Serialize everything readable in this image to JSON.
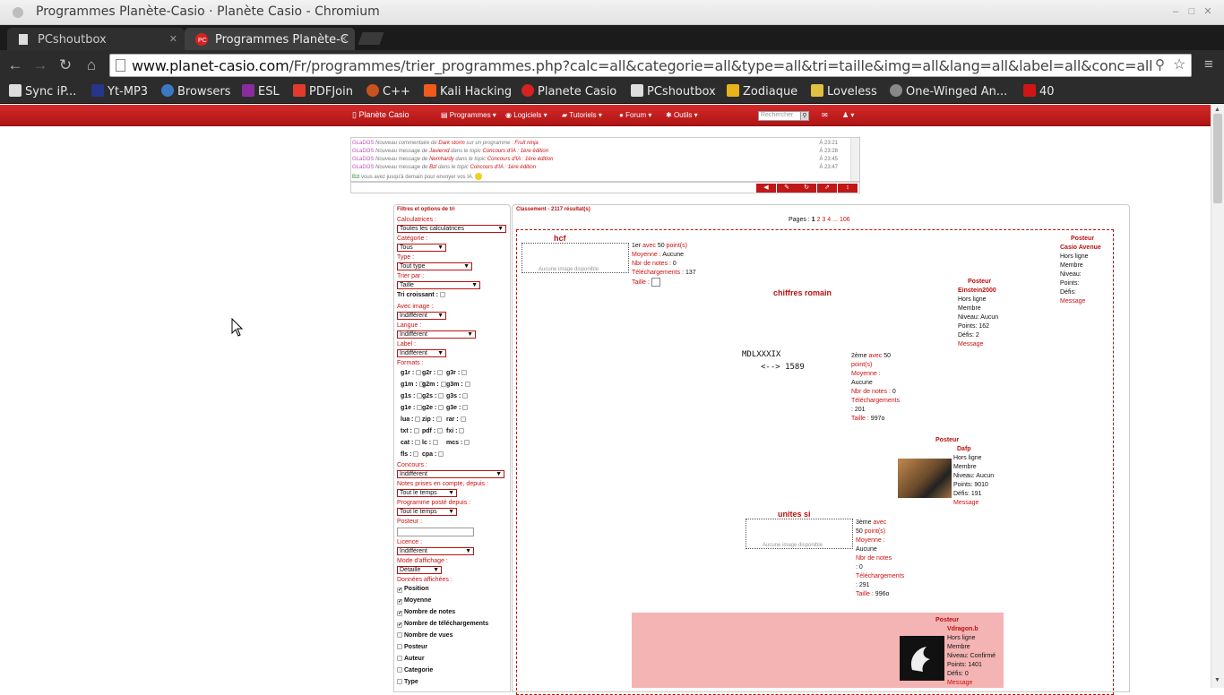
{
  "window": {
    "title": "Programmes Planète-Casio · Planète Casio - Chromium"
  },
  "tabs": [
    {
      "label": "PCshoutbox"
    },
    {
      "label": "Programmes Planète-C"
    }
  ],
  "address": {
    "host": "www.planet-casio.com",
    "path": "/Fr/programmes/trier_programmes.php?calc=all&categorie=all&type=all&tri=taille&img=all&lang=all&label=all&conc=all&not"
  },
  "bookmarks": [
    "Sync iP...",
    "Yt-MP3",
    "Browsers",
    "ESL",
    "PDFJoin",
    "C++",
    "Kali Hacking",
    "Planete Casio",
    "PCshoutbox",
    "Zodiaque",
    "Loveless",
    "One-Winged An...",
    "40"
  ],
  "site": {
    "brand": "Planète Casio",
    "menu": [
      "Programmes",
      "Logiciels",
      "Tutoriels",
      "Forum",
      "Outils"
    ],
    "search_placeholder": "Rechercher"
  },
  "shoutbox": [
    {
      "user": "GLaDOS",
      "text": "Nouveau commentaire de ",
      "who": "Dark storm",
      "mid": " sur un programme : ",
      "what": "Fruit ninja",
      "time": "À 23:21"
    },
    {
      "user": "GLaDOS",
      "text": "Nouveau message de ",
      "who": "Javierxd",
      "mid": " dans le topic ",
      "what": "Concours d'IA : 1ère édition",
      "time": "À 23:28"
    },
    {
      "user": "GLaDOS",
      "text": "Nouveau message de ",
      "who": "Nemhardy",
      "mid": " dans le topic ",
      "what": "Concours d'IA : 1ère édition",
      "time": "À 23:45"
    },
    {
      "user": "GLaDOS",
      "text": "Nouveau message de ",
      "who": "Bzl",
      "mid": " dans le topic ",
      "what": "Concours d'IA : 1ère édition",
      "time": "À 23:47"
    },
    {
      "user": "Bzl",
      "text": "vous avez jusqu'à demain pour envoyer vos IA.",
      "who": "",
      "mid": "",
      "what": "",
      "time": ""
    }
  ],
  "filters": {
    "title": "Filtres et options de tri",
    "calc_label": "Calculatrices :",
    "calc_value": "Toutes les calculatrices",
    "cat_label": "Catégorie :",
    "cat_value": "Tous",
    "type_label": "Type :",
    "type_value": "Tout type",
    "sort_label": "Trier par :",
    "sort_value": "Taille",
    "asc_label": "Tri croissant :",
    "img_label": "Avec image :",
    "img_value": "Indifférent",
    "lang_label": "Langue :",
    "lang_value": "Indifférent",
    "label_label": "Label :",
    "label_value": "Indifférent",
    "formats_label": "Formats :",
    "formats": [
      "g1r :",
      "g2r :",
      "g3r :",
      "g1m :",
      "g2m :",
      "g3m :",
      "g1s :",
      "g2s :",
      "g3s :",
      "g1e :",
      "g2e :",
      "g3e :",
      "lua :",
      "zip :",
      "rar :",
      "txt :",
      "pdf :",
      "fxi :",
      "cat :",
      "lc :",
      "mcs :",
      "fls :",
      "cpa :"
    ],
    "conc_label": "Concours :",
    "conc_value": "Indifférent",
    "notes_label": "Notes prises en compte, depuis :",
    "notes_value": "Tout le temps",
    "posted_label": "Programme posté depuis :",
    "posted_value": "Tout le temps",
    "poster_label": "Posteur :",
    "licence_label": "Licence :",
    "licence_value": "Indifférent",
    "mode_label": "Mode d'affichage :",
    "mode_value": "Détaillé",
    "data_label": "Données affichées :",
    "data": [
      {
        "label": "Position",
        "checked": true
      },
      {
        "label": "Moyenne",
        "checked": true
      },
      {
        "label": "Nombre de notes",
        "checked": true
      },
      {
        "label": "Nombre de téléchargements",
        "checked": true
      },
      {
        "label": "Nombre de vues",
        "checked": false
      },
      {
        "label": "Posteur",
        "checked": false
      },
      {
        "label": "Auteur",
        "checked": false
      },
      {
        "label": "Categorie",
        "checked": false
      },
      {
        "label": "Type",
        "checked": false
      }
    ]
  },
  "results": {
    "title": "Classement - 2117 résultat(s)",
    "pages_label": "Pages :",
    "pages": [
      "1",
      "2",
      "3",
      "4",
      "...",
      "106"
    ],
    "noimg": "Aucune image disponible",
    "items": [
      {
        "name": "hcf",
        "rank": "1er",
        "avec": "avec",
        "pts": "50",
        "ptslabel": "point(s)",
        "moy_label": "Moyenne :",
        "moy": "Aucune",
        "notes_label": "Nbr de notes :",
        "notes": "0",
        "dl_label": "Téléchargements :",
        "dl": "137",
        "size_label": "Taille :",
        "size": "",
        "poster_head": "Posteur",
        "poster": "Casio Avenue",
        "status": "Hors ligne",
        "role": "Membre",
        "niveau": "Niveau:",
        "points": "Points:",
        "defis": "Défis:",
        "msg": "Message"
      },
      {
        "name": "chiffres romain",
        "code1": "MDLXXXIX",
        "code2": "<--> 1589",
        "rank": "2ème",
        "avec": "avec",
        "pts": "50",
        "ptslabel": "point(s)",
        "moy_label": "Moyenne :",
        "moy": "Aucune",
        "notes_label": "Nbr de notes :",
        "notes": "0",
        "dl_label": "Téléchargements",
        "dl": ": 201",
        "size_label": "Taille :",
        "size": "997o",
        "poster_head": "Posteur",
        "poster": "Einstein2000",
        "status": "Hors ligne",
        "role": "Membre",
        "niveau": "Niveau: Aucun",
        "points": "Points: 162",
        "defis": "Défis: 2",
        "msg": "Message"
      },
      {
        "name": "unites si",
        "rank": "3ème",
        "avec": "avec",
        "pts": "50",
        "ptslabel": "point(s)",
        "moy_label": "Moyenne :",
        "moy": "Aucune",
        "notes_label": "Nbr de notes",
        "notes": ": 0",
        "dl_label": "Téléchargements",
        "dl": ": 291",
        "size_label": "Taille :",
        "size": "996o",
        "poster_head": "Posteur",
        "poster": "Dafp",
        "status": "Hors ligne",
        "role": "Membre",
        "niveau": "Niveau: Aucun",
        "points": "Points: 9010",
        "defis": "Défis: 191",
        "msg": "Message"
      },
      {
        "poster_head": "Posteur",
        "poster": "Vdragon.b",
        "status": "Hors ligne",
        "role": "Membre",
        "niveau": "Niveau: Confirmé",
        "points": "Points: 1401",
        "defis": "Défis: 0",
        "msg": "Message"
      }
    ]
  }
}
